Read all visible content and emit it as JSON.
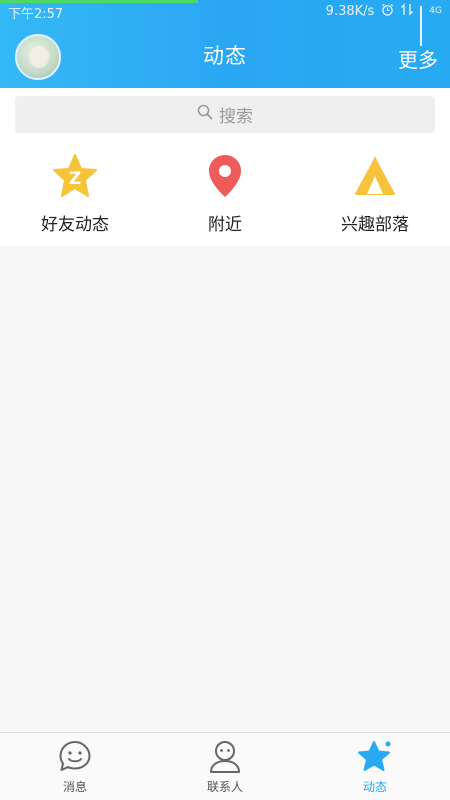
{
  "status_bar": {
    "time": "下午2:57",
    "network_speed": "9.38K/s",
    "network_type": "4G"
  },
  "header": {
    "title": "动态",
    "more_label": "更多"
  },
  "search": {
    "placeholder": "搜索"
  },
  "quick_entries": [
    {
      "label": "好友动态",
      "icon": "qzone-star-icon",
      "color": "#f7c33b"
    },
    {
      "label": "附近",
      "icon": "location-pin-icon",
      "color": "#ef5b5b"
    },
    {
      "label": "兴趣部落",
      "icon": "tent-icon",
      "color": "#f7c33b"
    }
  ],
  "tabbar": {
    "items": [
      {
        "label": "消息",
        "icon": "chat-smile-icon"
      },
      {
        "label": "联系人",
        "icon": "contact-person-icon"
      },
      {
        "label": "动态",
        "icon": "star-icon",
        "active": true
      }
    ]
  },
  "colors": {
    "header_gradient_start": "#35b8f6",
    "header_gradient_end": "#28aaf2",
    "accent": "#28aaf2",
    "progress": "#4cd964"
  }
}
